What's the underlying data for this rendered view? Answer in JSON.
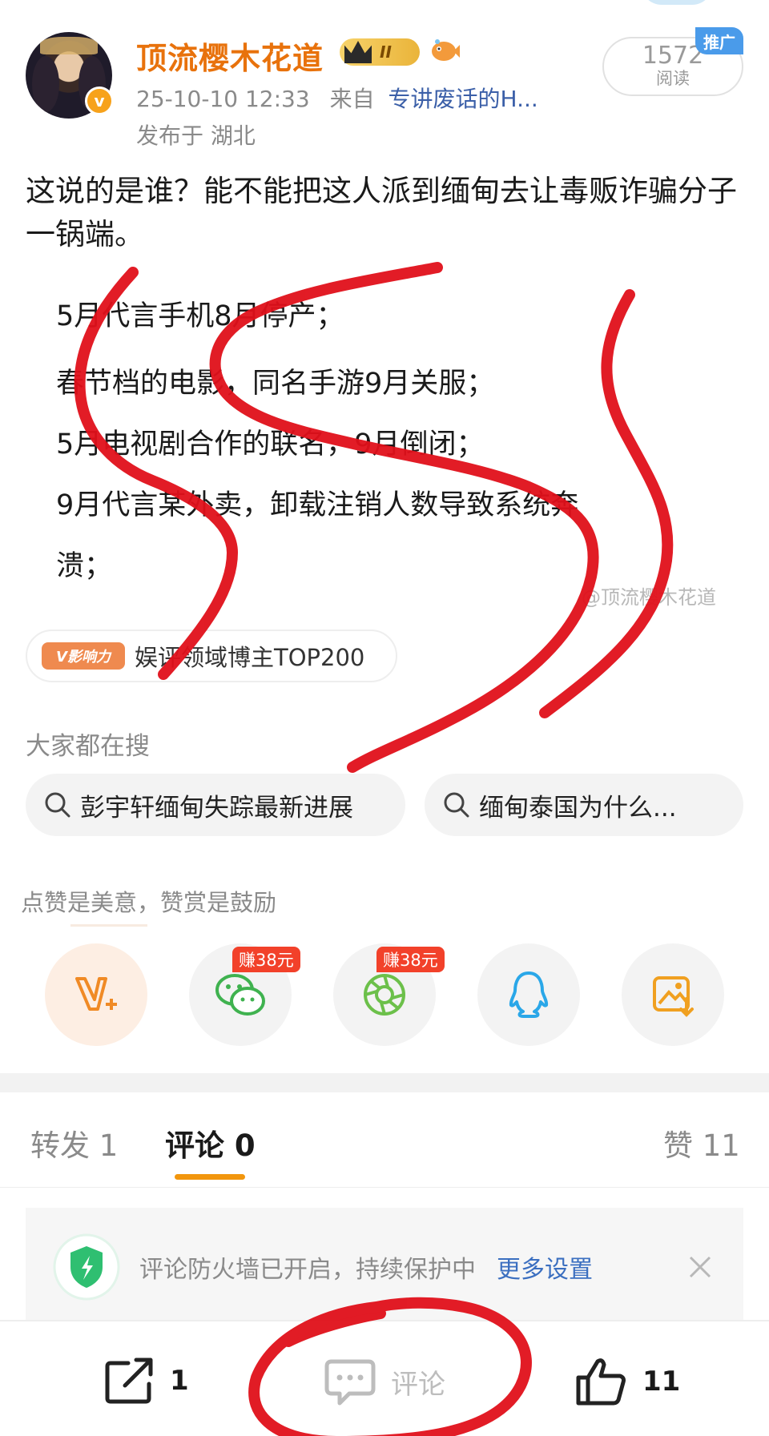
{
  "header": {
    "username": "顶流樱木花道",
    "level": "II",
    "time": "25-10-10 12:33",
    "from_label": "来自",
    "source": "专讲废话的H...",
    "location": "发布于 湖北",
    "read_count": "1572",
    "read_label": "阅读",
    "ad_tag": "推广",
    "verified_mark": "v"
  },
  "post": {
    "text": "这说的是谁？能不能把这人派到缅甸去让毒贩诈骗分子一锅端。"
  },
  "image_text": {
    "lines": [
      "5月代言手机8月停产；",
      "春节档的电影，同名手游9月关服；",
      "5月电视剧合作的联名，9月倒闭；",
      "9月代言某外卖，卸载注销人数导致系统奔",
      "溃；"
    ],
    "watermark": "@顶流樱木花道"
  },
  "influence": {
    "tag": "V影响力",
    "text": "娱评领域博主TOP200"
  },
  "search": {
    "title": "大家都在搜",
    "chips": [
      "彭宇轩缅甸失踪最新进展",
      "缅甸泰国为什么..."
    ]
  },
  "reward": {
    "title": "点赞是美意，赞赏是鼓励",
    "earn_badge_1": "赚38元",
    "earn_badge_2": "赚38元"
  },
  "tabs": {
    "repost": "转发 1",
    "comment": "评论 0",
    "like": "赞 11"
  },
  "firewall": {
    "text": "评论防火墙已开启，持续保护中",
    "more": "更多设置"
  },
  "bottom_bar": {
    "share_count": "1",
    "comment_label": "评论",
    "like_count": "11"
  },
  "colors": {
    "username": "#e8720c",
    "link": "#3b5fa8",
    "tab_underline": "#f2960d",
    "earn_badge": "#f2412a",
    "scribble": "#e0101a"
  }
}
